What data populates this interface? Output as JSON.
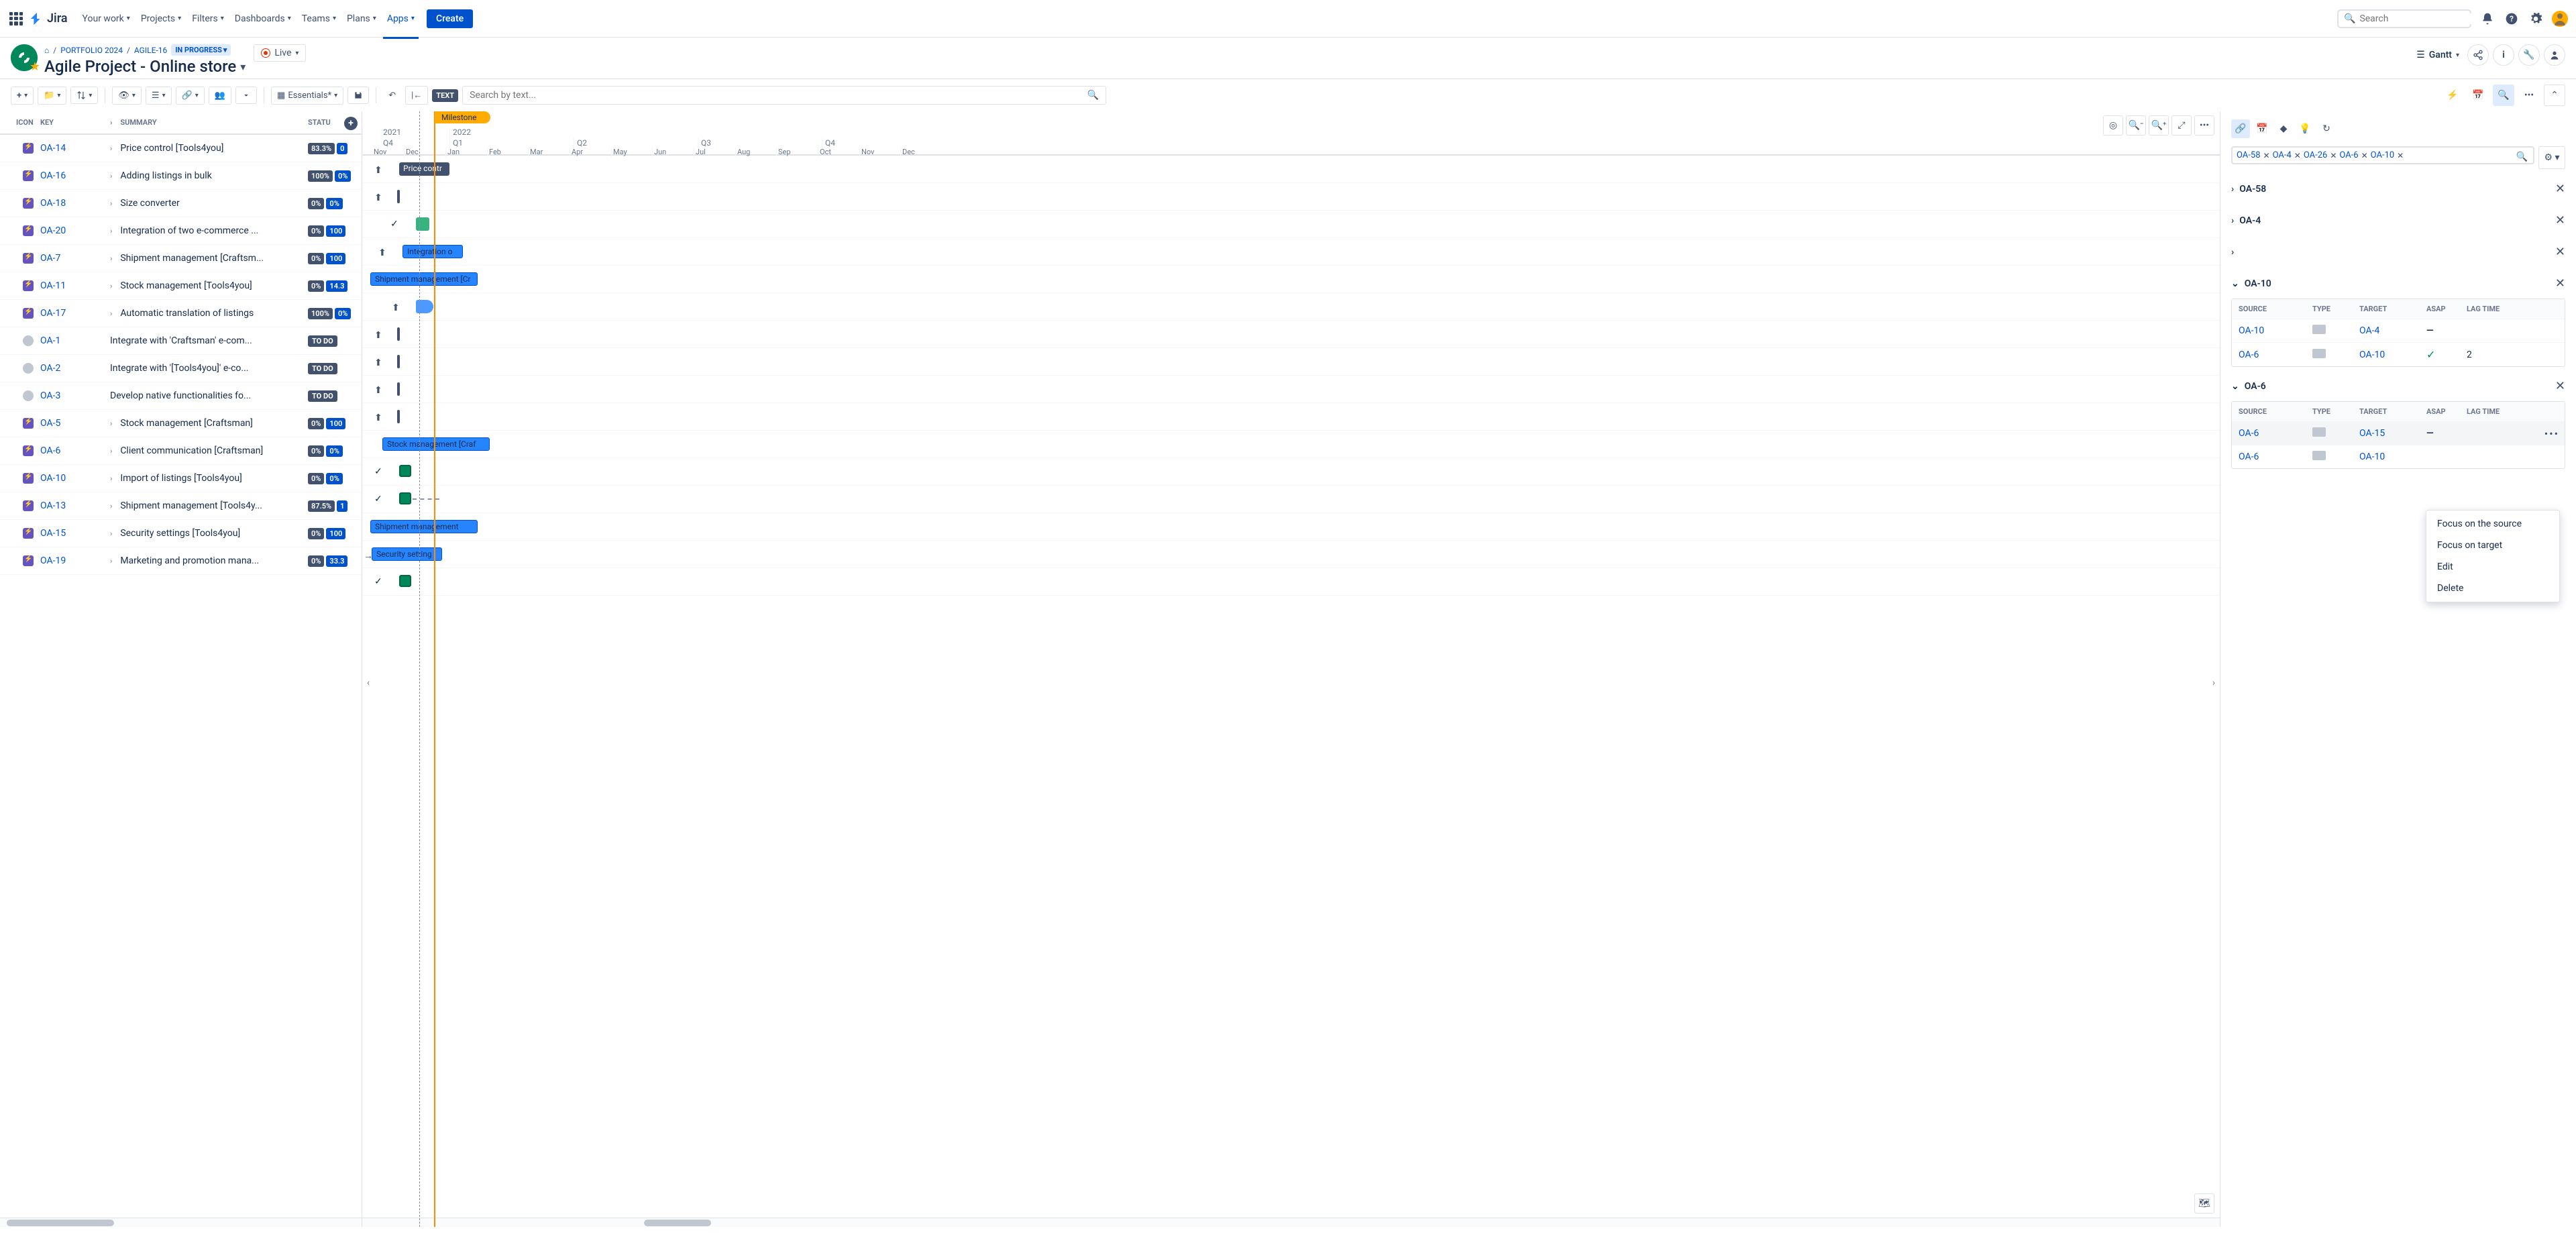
{
  "topnav": {
    "logo": "Jira",
    "items": [
      "Your work",
      "Projects",
      "Filters",
      "Dashboards",
      "Teams",
      "Plans",
      "Apps"
    ],
    "active_index": 6,
    "create": "Create",
    "search_placeholder": "Search"
  },
  "header": {
    "breadcrumb_home": "⌂",
    "breadcrumb_portfolio": "PORTFOLIO 2024",
    "breadcrumb_key": "AGILE-16",
    "status": "IN PROGRESS",
    "title": "Agile Project - Online store",
    "live": "Live",
    "view": "Gantt"
  },
  "toolbar": {
    "essentials": "Essentials*",
    "text": "TEXT",
    "search_placeholder": "Search by text..."
  },
  "grid": {
    "columns": {
      "icon": "ICON",
      "key": "KEY",
      "summary": "SUMMARY",
      "status": "STATU"
    },
    "rows": [
      {
        "type": "epic",
        "key": "OA-14",
        "summary": "Price control [Tools4you]",
        "pct": "83.3%",
        "pct2": "0",
        "expandable": true
      },
      {
        "type": "epic",
        "key": "OA-16",
        "summary": "Adding listings in bulk",
        "pct": "100%",
        "pct2": "0%",
        "expandable": true
      },
      {
        "type": "epic",
        "key": "OA-18",
        "summary": "Size converter",
        "pct": "0%",
        "pct2": "0%",
        "expandable": true
      },
      {
        "type": "epic",
        "key": "OA-20",
        "summary": "Integration of two e-commerce ...",
        "pct": "0%",
        "pct2": "100",
        "expandable": true
      },
      {
        "type": "epic",
        "key": "OA-7",
        "summary": "Shipment management [Craftsm...",
        "pct": "0%",
        "pct2": "100",
        "expandable": true
      },
      {
        "type": "epic",
        "key": "OA-11",
        "summary": "Stock management [Tools4you]",
        "pct": "0%",
        "pct2": "14.3",
        "expandable": true
      },
      {
        "type": "epic",
        "key": "OA-17",
        "summary": "Automatic translation of listings",
        "pct": "100%",
        "pct2": "0%",
        "expandable": true
      },
      {
        "type": "task",
        "key": "OA-1",
        "summary": "Integrate with 'Craftsman' e-com...",
        "status": "TO DO",
        "expandable": false
      },
      {
        "type": "task",
        "key": "OA-2",
        "summary": "Integrate with '[Tools4you]' e-co...",
        "status": "TO DO",
        "expandable": false
      },
      {
        "type": "task",
        "key": "OA-3",
        "summary": "Develop native functionalities fo...",
        "status": "TO DO",
        "expandable": false
      },
      {
        "type": "epic",
        "key": "OA-5",
        "summary": "Stock management [Craftsman]",
        "pct": "0%",
        "pct2": "100",
        "expandable": true
      },
      {
        "type": "epic",
        "key": "OA-6",
        "summary": "Client communication [Craftsman]",
        "pct": "0%",
        "pct2": "0%",
        "expandable": true
      },
      {
        "type": "epic",
        "key": "OA-10",
        "summary": "Import of listings [Tools4you]",
        "pct": "0%",
        "pct2": "0%",
        "expandable": true
      },
      {
        "type": "epic",
        "key": "OA-13",
        "summary": "Shipment management [Tools4y...",
        "pct": "87.5%",
        "pct2": "1",
        "expandable": true
      },
      {
        "type": "epic",
        "key": "OA-15",
        "summary": "Security settings [Tools4you]",
        "pct": "0%",
        "pct2": "100",
        "expandable": true
      },
      {
        "type": "epic",
        "key": "OA-19",
        "summary": "Marketing and promotion mana...",
        "pct": "0%",
        "pct2": "33.3",
        "expandable": true
      }
    ]
  },
  "gantt": {
    "milestone": "Milestone",
    "years": [
      "2021",
      "2022"
    ],
    "quarters": [
      "Q4",
      "Q1",
      "Q2",
      "Q3",
      "Q4"
    ],
    "months": [
      "Nov",
      "Dec",
      "Jan",
      "Feb",
      "Mar",
      "Apr",
      "May",
      "Jun",
      "Jul",
      "Aug",
      "Sep",
      "Oct",
      "Nov",
      "Dec"
    ],
    "bars": {
      "price_contr": "Price contr",
      "integration": "Integration o",
      "shipment_craft": "Shipment management [Cr",
      "stock_craft": "Stock management [Craf",
      "shipment": "Shipment management",
      "security": "Security setting"
    }
  },
  "side": {
    "chips": [
      "OA-58",
      "OA-4",
      "OA-26",
      "OA-6",
      "OA-10"
    ],
    "groups": [
      {
        "key": "OA-58",
        "collapsed": true
      },
      {
        "key": "OA-4",
        "collapsed": true
      },
      {
        "key": "",
        "collapsed": true
      },
      {
        "key": "OA-10",
        "collapsed": false,
        "cols": {
          "source": "SOURCE",
          "type": "TYPE",
          "target": "TARGET",
          "asap": "ASAP",
          "lag": "LAG TIME"
        },
        "rows": [
          {
            "source": "OA-10",
            "target": "OA-4",
            "asap": "dash",
            "lag": ""
          },
          {
            "source": "OA-6",
            "target": "OA-10",
            "asap": "check",
            "lag": "2"
          }
        ]
      },
      {
        "key": "OA-6",
        "collapsed": false,
        "cols": {
          "source": "SOURCE",
          "type": "TYPE",
          "target": "TARGET",
          "asap": "ASAP",
          "lag": "LAG TIME"
        },
        "rows": [
          {
            "source": "OA-6",
            "target": "OA-15",
            "asap": "dash",
            "lag": "",
            "hover": true
          },
          {
            "source": "OA-6",
            "target": "OA-10",
            "asap": "",
            "lag": ""
          }
        ]
      }
    ]
  },
  "ctx": {
    "focus_source": "Focus on the source",
    "focus_target": "Focus on target",
    "edit": "Edit",
    "delete": "Delete"
  }
}
